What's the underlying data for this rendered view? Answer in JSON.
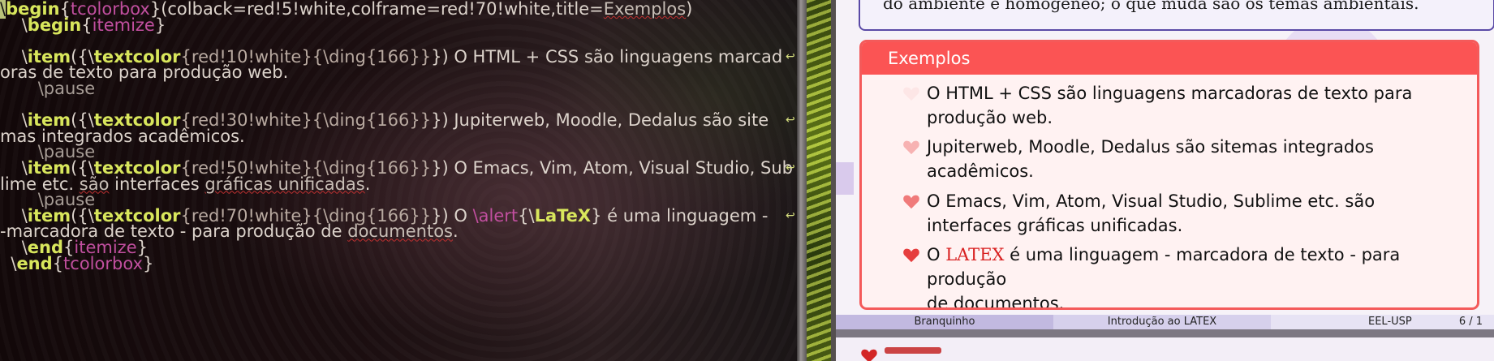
{
  "editor": {
    "lines": [
      {
        "parts": [
          [
            "cursor",
            "\\"
          ],
          [
            "kw",
            "begin"
          ],
          [
            "txt",
            "{"
          ],
          [
            "arg",
            "tcolorbox"
          ],
          [
            "txt",
            "}(colback=red!5!white,colframe=red!70!white,title="
          ],
          [
            "wave",
            "Exemplos"
          ],
          [
            "txt",
            ")"
          ]
        ]
      },
      {
        "parts": [
          [
            "txt",
            "    \\"
          ],
          [
            "kw",
            "begin"
          ],
          [
            "txt",
            "{"
          ],
          [
            "arg",
            "itemize"
          ],
          [
            "txt",
            "}"
          ]
        ]
      },
      {
        "parts": [
          [
            "txt",
            " "
          ]
        ]
      },
      {
        "parts": [
          [
            "txt",
            "    \\"
          ],
          [
            "kw",
            "item"
          ],
          [
            "txt",
            "({\\"
          ],
          [
            "kw",
            "textcolor"
          ],
          [
            "colarg",
            "{red!10!white}{\\ding{166}}"
          ],
          [
            "txt",
            "}) O HTML + CSS são linguagens marcad"
          ]
        ]
      },
      {
        "parts": [
          [
            "txt",
            "oras de texto para produção web."
          ]
        ]
      },
      {
        "parts": [
          [
            "cmdin",
            "       \\pause"
          ]
        ]
      },
      {
        "parts": [
          [
            "txt",
            " "
          ]
        ]
      },
      {
        "parts": [
          [
            "txt",
            "    \\"
          ],
          [
            "kw",
            "item"
          ],
          [
            "txt",
            "({\\"
          ],
          [
            "kw",
            "textcolor"
          ],
          [
            "colarg",
            "{red!30!white}{\\ding{166}}"
          ],
          [
            "txt",
            "}) Jupiterweb, Moodle, Dedalus são site"
          ]
        ]
      },
      {
        "parts": [
          [
            "txt",
            "mas integrados acadêmicos."
          ]
        ]
      },
      {
        "parts": [
          [
            "cmdin",
            "       \\pause"
          ]
        ]
      },
      {
        "parts": [
          [
            "txt",
            "    \\"
          ],
          [
            "kw",
            "item"
          ],
          [
            "txt",
            "({\\"
          ],
          [
            "kw",
            "textcolor"
          ],
          [
            "colarg",
            "{red!50!white}{\\ding{166}}"
          ],
          [
            "txt",
            "}) O Emacs, Vim, Atom, Visual Studio, Sub"
          ]
        ]
      },
      {
        "parts": [
          [
            "txt",
            "lime etc. "
          ],
          [
            "wave",
            "são"
          ],
          [
            "txt",
            " interfaces "
          ],
          [
            "wave",
            "gráficas unificadas"
          ],
          [
            "txt",
            "."
          ]
        ]
      },
      {
        "parts": [
          [
            "cmdin",
            "       \\pause"
          ]
        ]
      },
      {
        "parts": [
          [
            "txt",
            "    \\"
          ],
          [
            "kw",
            "item"
          ],
          [
            "txt",
            "({\\"
          ],
          [
            "kw",
            "textcolor"
          ],
          [
            "colarg",
            "{red!70!white}{\\ding{166}}"
          ],
          [
            "txt",
            "}) O "
          ],
          [
            "arg",
            "\\alert"
          ],
          [
            "txt",
            "{\\"
          ],
          [
            "kw",
            "LaTeX"
          ],
          [
            "txt",
            "} é uma linguagem -"
          ]
        ]
      },
      {
        "parts": [
          [
            "txt",
            "-marcadora de texto - para produção de "
          ],
          [
            "wave",
            "documentos"
          ],
          [
            "txt",
            "."
          ]
        ]
      },
      {
        "parts": [
          [
            "txt",
            "    \\"
          ],
          [
            "kw",
            "end"
          ],
          [
            "txt",
            "{"
          ],
          [
            "arg",
            "itemize"
          ],
          [
            "txt",
            "}"
          ]
        ]
      },
      {
        "parts": [
          [
            "txt",
            "  \\"
          ],
          [
            "kw",
            "end"
          ],
          [
            "txt",
            "{"
          ],
          [
            "arg",
            "tcolorbox"
          ],
          [
            "txt",
            "}"
          ]
        ]
      }
    ]
  },
  "viewer": {
    "prev_text": "do ambiente é homogêneo; o que muda são os temas ambientais.",
    "box_title": "Exemplos",
    "items": [
      {
        "line1": "O HTML + CSS são linguagens marcadoras de texto para",
        "line2": "produção web.",
        "bullet_color": "#fde6e6"
      },
      {
        "line1": "Jupiterweb, Moodle, Dedalus são sitemas integrados",
        "line2": "acadêmicos.",
        "bullet_color": "#f7b2b2"
      },
      {
        "line1": "O Emacs, Vim, Atom, Visual Studio, Sublime etc. são",
        "line2": "interfaces gráficas unificadas.",
        "bullet_color": "#f07a7a"
      },
      {
        "line1_pre": "O ",
        "latex": "LATEX",
        "line1_post": " é uma linguagem - marcadora de texto - para produção",
        "line2": "de documentos.",
        "bullet_color": "#e63e3e"
      }
    ],
    "footer": {
      "author": "Branquinho",
      "title": "Introdução ao LATEX",
      "institution": "EEL-USP",
      "page": "6 / 1"
    }
  },
  "colors": {
    "box_frame": "#f45a5a",
    "box_back": "#fff2f2",
    "keyword": "#d8e65c",
    "argument": "#c14f9f"
  }
}
